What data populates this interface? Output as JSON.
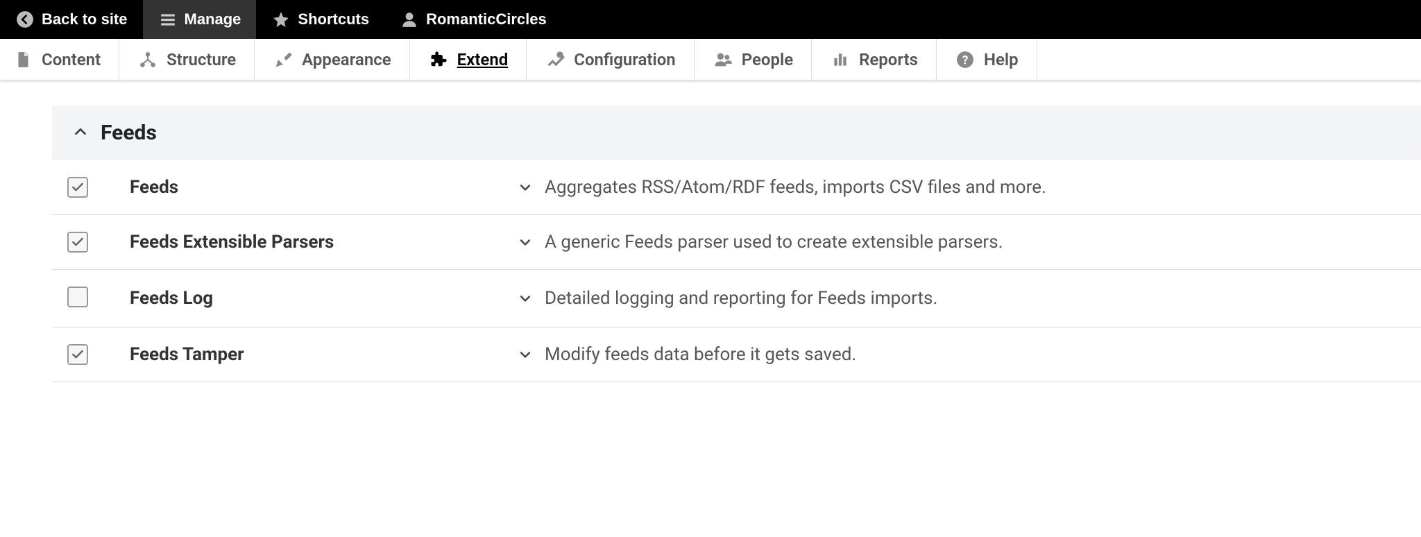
{
  "toolbar": {
    "back": "Back to site",
    "manage": "Manage",
    "shortcuts": "Shortcuts",
    "user": "RomanticCircles"
  },
  "admin_nav": {
    "content": "Content",
    "structure": "Structure",
    "appearance": "Appearance",
    "extend": "Extend",
    "configuration": "Configuration",
    "people": "People",
    "reports": "Reports",
    "help": "Help",
    "active": "extend"
  },
  "group": {
    "title": "Feeds",
    "expanded": true
  },
  "modules": [
    {
      "name": "Feeds",
      "description": "Aggregates RSS/Atom/RDF feeds, imports CSV files and more.",
      "enabled": true
    },
    {
      "name": "Feeds Extensible Parsers",
      "description": "A generic Feeds parser used to create extensible parsers.",
      "enabled": true
    },
    {
      "name": "Feeds Log",
      "description": "Detailed logging and reporting for Feeds imports.",
      "enabled": false
    },
    {
      "name": "Feeds Tamper",
      "description": "Modify feeds data before it gets saved.",
      "enabled": true
    }
  ]
}
